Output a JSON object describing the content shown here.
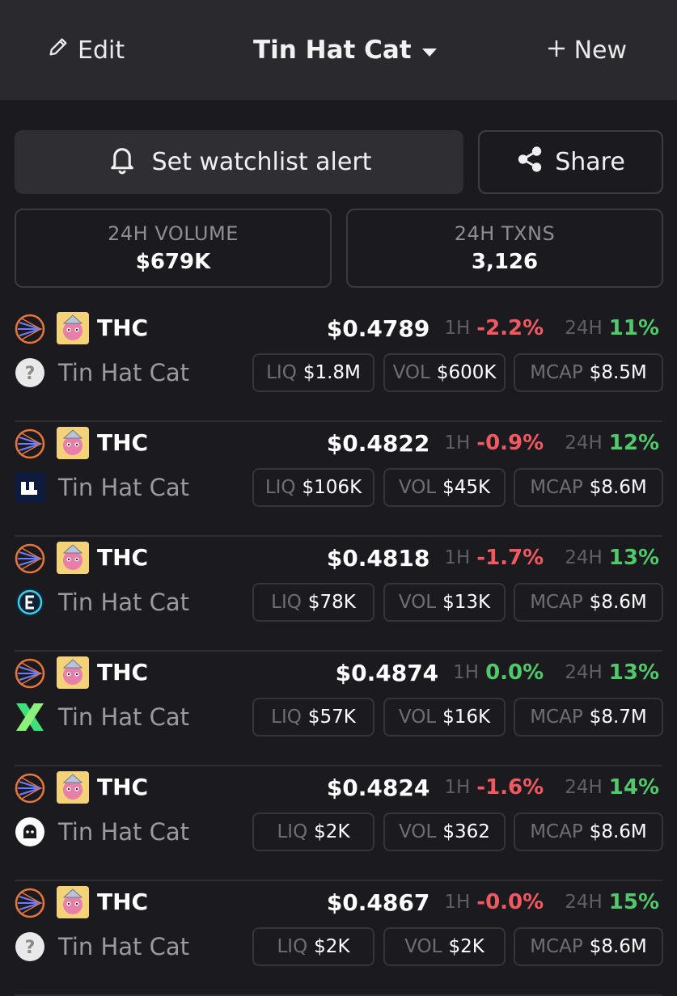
{
  "header": {
    "edit_label": "Edit",
    "title": "Tin Hat Cat",
    "new_label": "New"
  },
  "actions": {
    "alert_label": "Set watchlist alert",
    "share_label": "Share"
  },
  "stats": {
    "volume_label": "24H VOLUME",
    "volume_value": "$679K",
    "txns_label": "24H TXNS",
    "txns_value": "3,126"
  },
  "labels": {
    "h1": "1H",
    "h24": "24H",
    "liq": "LIQ",
    "vol": "VOL",
    "mcap": "MCAP"
  },
  "colors": {
    "negative": "#f0595f",
    "positive": "#4fc96a",
    "background": "#1b1b1f"
  },
  "pairs": [
    {
      "symbol": "THC",
      "name": "Tin Hat Cat",
      "dex_icon": "unknown-question-icon",
      "price": "$0.4789",
      "change_1h": "-2.2%",
      "change_1h_dir": "neg",
      "change_24h": "11%",
      "change_24h_dir": "pos",
      "liq": "$1.8M",
      "vol": "$600K",
      "mcap": "$8.5M"
    },
    {
      "symbol": "THC",
      "name": "Tin Hat Cat",
      "dex_icon": "dex-logo-blocks-icon",
      "price": "$0.4822",
      "change_1h": "-0.9%",
      "change_1h_dir": "neg",
      "change_24h": "12%",
      "change_24h_dir": "pos",
      "liq": "$106K",
      "vol": "$45K",
      "mcap": "$8.6M"
    },
    {
      "symbol": "THC",
      "name": "Tin Hat Cat",
      "dex_icon": "dex-logo-circle-e-icon",
      "price": "$0.4818",
      "change_1h": "-1.7%",
      "change_1h_dir": "neg",
      "change_24h": "13%",
      "change_24h_dir": "pos",
      "liq": "$78K",
      "vol": "$13K",
      "mcap": "$8.6M"
    },
    {
      "symbol": "THC",
      "name": "Tin Hat Cat",
      "dex_icon": "dex-logo-green-x-icon",
      "price": "$0.4874",
      "change_1h": "0.0%",
      "change_1h_dir": "pos",
      "change_24h": "13%",
      "change_24h_dir": "pos",
      "liq": "$57K",
      "vol": "$16K",
      "mcap": "$8.7M"
    },
    {
      "symbol": "THC",
      "name": "Tin Hat Cat",
      "dex_icon": "dex-logo-ghost-icon",
      "price": "$0.4824",
      "change_1h": "-1.6%",
      "change_1h_dir": "neg",
      "change_24h": "14%",
      "change_24h_dir": "pos",
      "liq": "$2K",
      "vol": "$362",
      "mcap": "$8.6M"
    },
    {
      "symbol": "THC",
      "name": "Tin Hat Cat",
      "dex_icon": "unknown-question-icon",
      "price": "$0.4867",
      "change_1h": "-0.0%",
      "change_1h_dir": "neg",
      "change_24h": "15%",
      "change_24h_dir": "pos",
      "liq": "$2K",
      "vol": "$2K",
      "mcap": "$8.6M"
    }
  ]
}
